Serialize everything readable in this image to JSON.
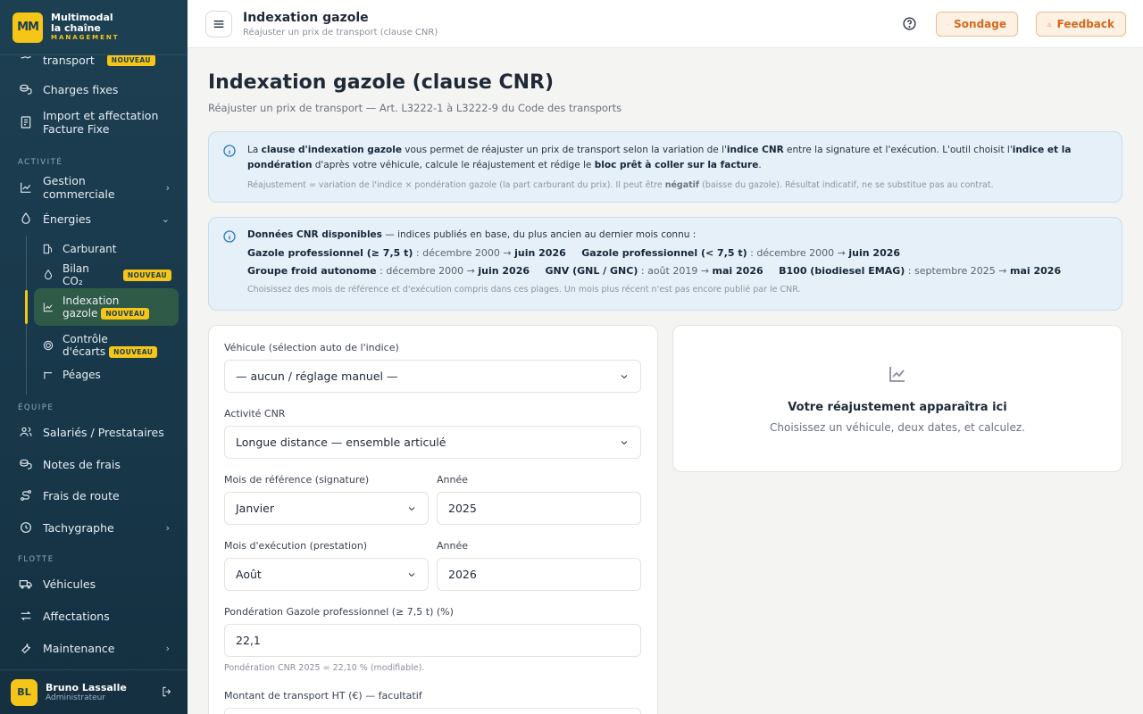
{
  "brand": {
    "logo": "MM",
    "name_line1": "Multimodal",
    "name_line2": "la chaîne",
    "subtitle": "MANAGEMENT"
  },
  "sidebar": {
    "items_top": [
      {
        "label": "transport",
        "badge": "NOUVEAU",
        "icon": "route-icon"
      },
      {
        "label": "Charges fixes",
        "icon": "coins-icon"
      },
      {
        "label_line1": "Import et affectation",
        "label_line2": "Facture Fixe",
        "icon": "invoice-icon"
      }
    ],
    "section_activite": "ACTIVITÉ",
    "gestion_commerciale": "Gestion commerciale",
    "energies": "Énergies",
    "sub_energies": [
      {
        "label": "Carburant"
      },
      {
        "label": "Bilan CO₂",
        "badge": "NOUVEAU"
      },
      {
        "label_line1": "Indexation",
        "label_line2": "gazole",
        "badge": "NOUVEAU"
      },
      {
        "label_line1": "Contrôle",
        "label_line2": "d'écarts",
        "badge": "NOUVEAU"
      },
      {
        "label": "Péages"
      }
    ],
    "section_equipe": "ÉQUIPE",
    "equipe": [
      "Salariés / Prestataires",
      "Notes de frais",
      "Frais de route",
      "Tachygraphe"
    ],
    "section_flotte": "FLOTTE",
    "flotte": [
      "Véhicules",
      "Affectations",
      "Maintenance"
    ]
  },
  "user": {
    "initials": "BL",
    "name": "Bruno Lassalle",
    "role": "Administrateur"
  },
  "topbar": {
    "title": "Indexation gazole",
    "subtitle": "Réajuster un prix de transport (clause CNR)",
    "sondage": "Sondage",
    "feedback": "Feedback"
  },
  "page": {
    "title": "Indexation gazole (clause CNR)",
    "subtitle": "Réajuster un prix de transport — Art. L3222-1 à L3222-9 du Code des transports"
  },
  "info1": {
    "p1": "La ",
    "b1": "clause d'indexation gazole",
    "p2": " vous permet de réajuster un prix de transport selon la variation de l'",
    "b2": "indice CNR",
    "p3": " entre la signature et l'exécution. L'outil choisit l'",
    "b3": "indice et la pondération",
    "p4": " d'après votre véhicule, calcule le réajustement et rédige le ",
    "b4": "bloc prêt à coller sur la facture",
    "p5": ".",
    "note1": "Réajustement = variation de l'indice × pondération gazole (la part carburant du prix). Il peut être ",
    "note_b": "négatif",
    "note2": " (baisse du gazole). Résultat indicatif, ne se substitue pas au contrat."
  },
  "info2": {
    "title": "Données CNR disponibles",
    "intro": " — indices publiés en base, du plus ancien au dernier mois connu :",
    "indices": [
      {
        "name": "Gazole professionnel (≥ 7,5 t)",
        "from": " : décembre 2000 → ",
        "to": "juin 2026"
      },
      {
        "name": "Gazole professionnel (< 7,5 t)",
        "from": " : décembre 2000 → ",
        "to": "juin 2026"
      },
      {
        "name": "Groupe froid autonome",
        "from": " : décembre 2000 → ",
        "to": "juin 2026"
      },
      {
        "name": "GNV (GNL / GNC)",
        "from": " : août 2019 → ",
        "to": "mai 2026"
      },
      {
        "name": "B100 (biodiesel EMAG)",
        "from": " : septembre 2025 → ",
        "to": "mai 2026"
      }
    ],
    "note": "Choisissez des mois de référence et d'exécution compris dans ces plages. Un mois plus récent n'est pas encore publié par le CNR."
  },
  "form": {
    "vehicule_label": "Véhicule (sélection auto de l'indice)",
    "vehicule_value": "— aucun / réglage manuel —",
    "activite_label": "Activité CNR",
    "activite_value": "Longue distance — ensemble articulé",
    "mois_ref_label": "Mois de référence (signature)",
    "mois_ref_value": "Janvier",
    "annee_label": "Année",
    "annee_ref_value": "2025",
    "mois_exec_label": "Mois d'exécution (prestation)",
    "mois_exec_value": "Août",
    "annee_exec_value": "2026",
    "ponderation_label": "Pondération Gazole professionnel (≥ 7,5 t) (%)",
    "ponderation_value": "22,1",
    "ponderation_hint": "Pondération CNR 2025 = 22,10 % (modifiable).",
    "montant_label": "Montant de transport HT (€) — facultatif"
  },
  "result": {
    "title": "Votre réajustement apparaîtra ici",
    "subtitle": "Choisissez un véhicule, deux dates, et calculez."
  },
  "colors": {
    "sidebar": "#1d3f52",
    "accent": "#f5c518",
    "info_bg": "#e6f0f8",
    "feedback": "#d2691e"
  }
}
